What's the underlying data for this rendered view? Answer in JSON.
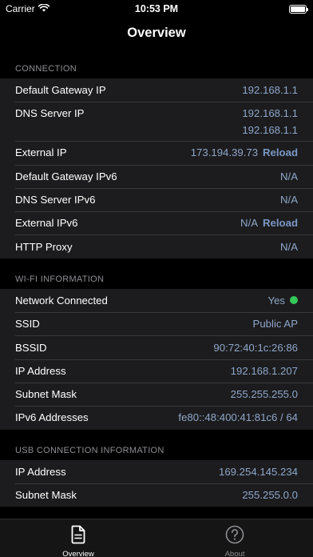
{
  "status_bar": {
    "carrier": "Carrier",
    "time": "10:53 PM"
  },
  "nav": {
    "title": "Overview"
  },
  "sections": {
    "connection": {
      "header": "CONNECTION",
      "default_gateway_ip": {
        "label": "Default Gateway IP",
        "value": "192.168.1.1"
      },
      "dns_server_ip": {
        "label": "DNS Server IP",
        "values": [
          "192.168.1.1",
          "192.168.1.1"
        ]
      },
      "external_ip": {
        "label": "External IP",
        "value": "173.194.39.73",
        "action": "Reload"
      },
      "default_gateway_ipv6": {
        "label": "Default Gateway IPv6",
        "value": "N/A"
      },
      "dns_server_ipv6": {
        "label": "DNS Server IPv6",
        "value": "N/A"
      },
      "external_ipv6": {
        "label": "External IPv6",
        "value": "N/A",
        "action": "Reload"
      },
      "http_proxy": {
        "label": "HTTP Proxy",
        "value": "N/A"
      }
    },
    "wifi": {
      "header": "WI-FI INFORMATION",
      "network_connected": {
        "label": "Network Connected",
        "value": "Yes",
        "indicator_color": "#34c759"
      },
      "ssid": {
        "label": "SSID",
        "value": "Public AP"
      },
      "bssid": {
        "label": "BSSID",
        "value": "90:72:40:1c:26:86"
      },
      "ip_address": {
        "label": "IP Address",
        "value": "192.168.1.207"
      },
      "subnet_mask": {
        "label": "Subnet Mask",
        "value": "255.255.255.0"
      },
      "ipv6_addresses": {
        "label": "IPv6 Addresses",
        "value": "fe80::48:400:41:81c6 / 64"
      }
    },
    "usb": {
      "header": "USB CONNECTION INFORMATION",
      "ip_address": {
        "label": "IP Address",
        "value": "169.254.145.234"
      },
      "subnet_mask": {
        "label": "Subnet Mask",
        "value": "255.255.0.0"
      }
    }
  },
  "tab_bar": {
    "overview": {
      "label": "Overview",
      "icon": "document-icon"
    },
    "about": {
      "label": "About",
      "icon": "question-circle-icon"
    }
  },
  "colors": {
    "value_text": "#8fa6c9",
    "cell_background": "#1c1c1e",
    "section_header": "#8e8e93"
  }
}
